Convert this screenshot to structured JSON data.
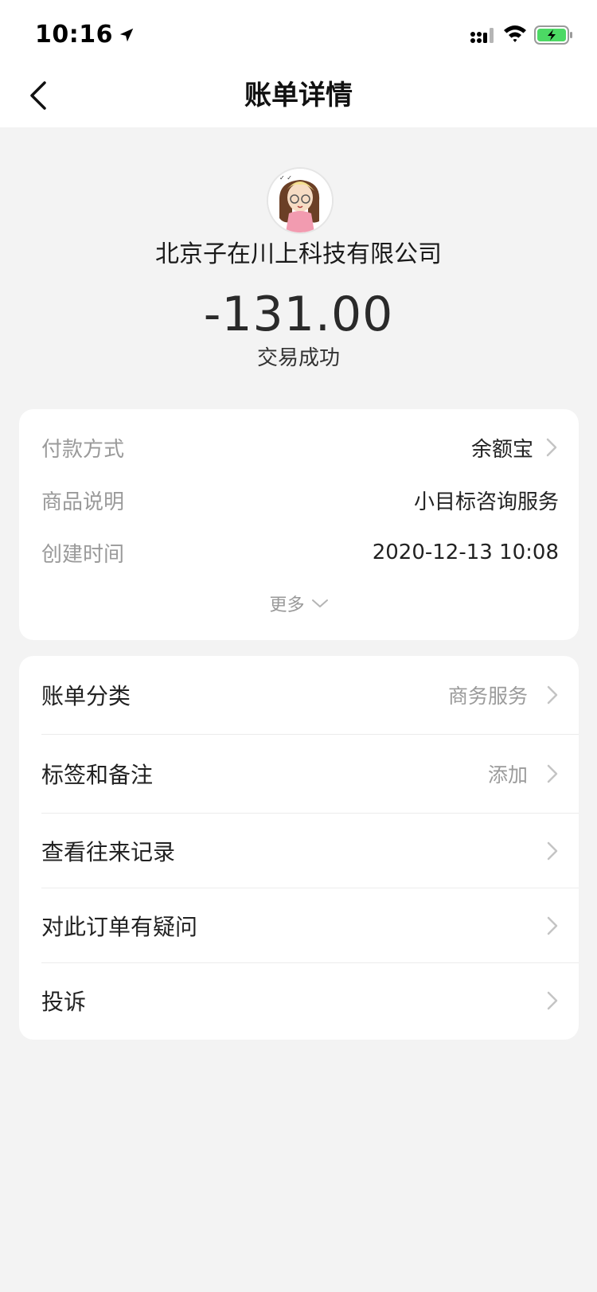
{
  "status_bar": {
    "time": "10:16"
  },
  "nav": {
    "title": "账单详情"
  },
  "header": {
    "merchant": "北京子在川上科技有限公司",
    "amount": "-131.00",
    "status": "交易成功"
  },
  "details": {
    "payment_method": {
      "label": "付款方式",
      "value": "余额宝"
    },
    "product": {
      "label": "商品说明",
      "value": "小目标咨询服务"
    },
    "created": {
      "label": "创建时间",
      "value": "2020-12-13 10:08"
    },
    "more_label": "更多"
  },
  "menu": {
    "category": {
      "label": "账单分类",
      "value": "商务服务"
    },
    "tags": {
      "label": "标签和备注",
      "value": "添加"
    },
    "records": {
      "label": "查看往来记录"
    },
    "question": {
      "label": "对此订单有疑问"
    },
    "complaint": {
      "label": "投诉"
    }
  },
  "colors": {
    "page_bg": "#f3f3f3",
    "card_bg": "#ffffff",
    "secondary_text": "#9a9a9a",
    "battery_green": "#4cd964"
  }
}
